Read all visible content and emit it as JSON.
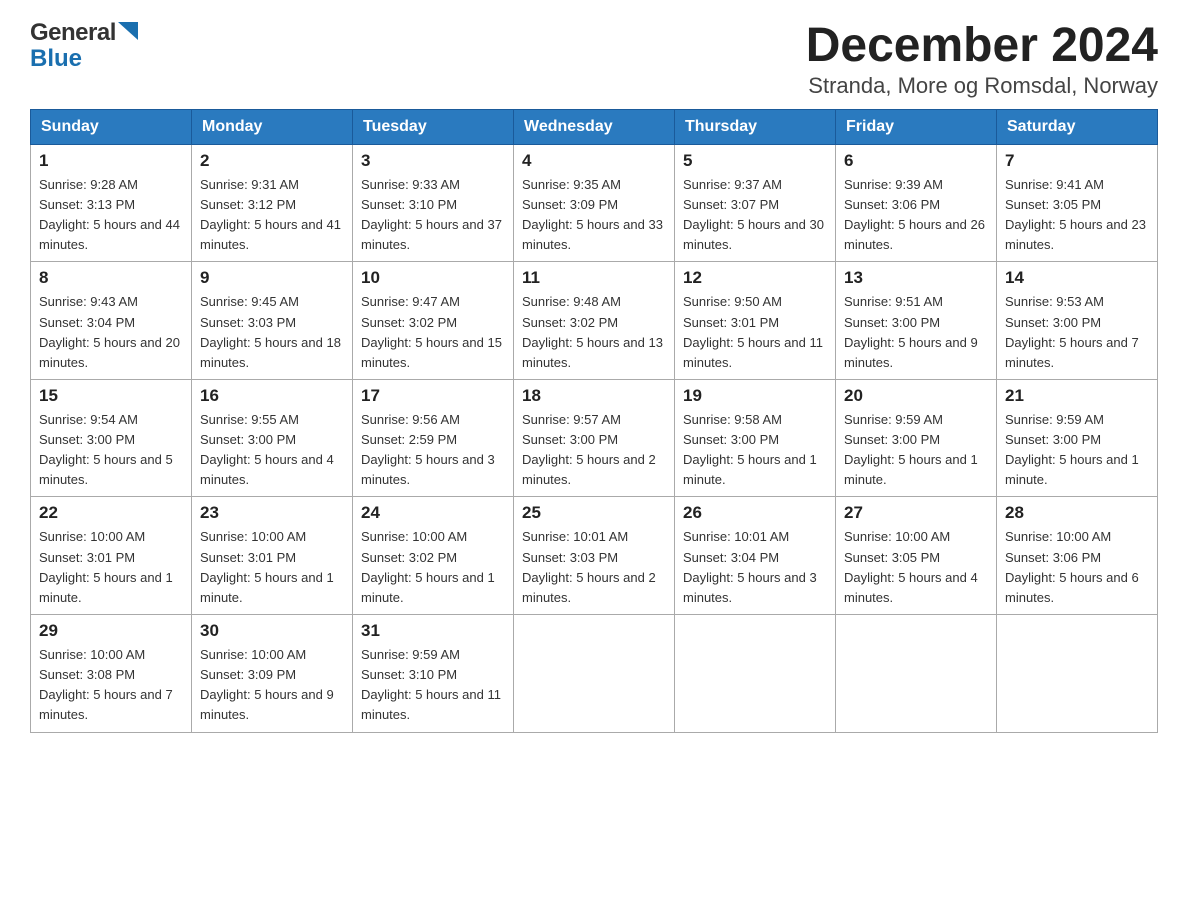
{
  "header": {
    "logo_general": "General",
    "logo_blue": "Blue",
    "title": "December 2024",
    "subtitle": "Stranda, More og Romsdal, Norway"
  },
  "days_of_week": [
    "Sunday",
    "Monday",
    "Tuesday",
    "Wednesday",
    "Thursday",
    "Friday",
    "Saturday"
  ],
  "weeks": [
    [
      {
        "num": "1",
        "sunrise": "Sunrise: 9:28 AM",
        "sunset": "Sunset: 3:13 PM",
        "daylight": "Daylight: 5 hours and 44 minutes."
      },
      {
        "num": "2",
        "sunrise": "Sunrise: 9:31 AM",
        "sunset": "Sunset: 3:12 PM",
        "daylight": "Daylight: 5 hours and 41 minutes."
      },
      {
        "num": "3",
        "sunrise": "Sunrise: 9:33 AM",
        "sunset": "Sunset: 3:10 PM",
        "daylight": "Daylight: 5 hours and 37 minutes."
      },
      {
        "num": "4",
        "sunrise": "Sunrise: 9:35 AM",
        "sunset": "Sunset: 3:09 PM",
        "daylight": "Daylight: 5 hours and 33 minutes."
      },
      {
        "num": "5",
        "sunrise": "Sunrise: 9:37 AM",
        "sunset": "Sunset: 3:07 PM",
        "daylight": "Daylight: 5 hours and 30 minutes."
      },
      {
        "num": "6",
        "sunrise": "Sunrise: 9:39 AM",
        "sunset": "Sunset: 3:06 PM",
        "daylight": "Daylight: 5 hours and 26 minutes."
      },
      {
        "num": "7",
        "sunrise": "Sunrise: 9:41 AM",
        "sunset": "Sunset: 3:05 PM",
        "daylight": "Daylight: 5 hours and 23 minutes."
      }
    ],
    [
      {
        "num": "8",
        "sunrise": "Sunrise: 9:43 AM",
        "sunset": "Sunset: 3:04 PM",
        "daylight": "Daylight: 5 hours and 20 minutes."
      },
      {
        "num": "9",
        "sunrise": "Sunrise: 9:45 AM",
        "sunset": "Sunset: 3:03 PM",
        "daylight": "Daylight: 5 hours and 18 minutes."
      },
      {
        "num": "10",
        "sunrise": "Sunrise: 9:47 AM",
        "sunset": "Sunset: 3:02 PM",
        "daylight": "Daylight: 5 hours and 15 minutes."
      },
      {
        "num": "11",
        "sunrise": "Sunrise: 9:48 AM",
        "sunset": "Sunset: 3:02 PM",
        "daylight": "Daylight: 5 hours and 13 minutes."
      },
      {
        "num": "12",
        "sunrise": "Sunrise: 9:50 AM",
        "sunset": "Sunset: 3:01 PM",
        "daylight": "Daylight: 5 hours and 11 minutes."
      },
      {
        "num": "13",
        "sunrise": "Sunrise: 9:51 AM",
        "sunset": "Sunset: 3:00 PM",
        "daylight": "Daylight: 5 hours and 9 minutes."
      },
      {
        "num": "14",
        "sunrise": "Sunrise: 9:53 AM",
        "sunset": "Sunset: 3:00 PM",
        "daylight": "Daylight: 5 hours and 7 minutes."
      }
    ],
    [
      {
        "num": "15",
        "sunrise": "Sunrise: 9:54 AM",
        "sunset": "Sunset: 3:00 PM",
        "daylight": "Daylight: 5 hours and 5 minutes."
      },
      {
        "num": "16",
        "sunrise": "Sunrise: 9:55 AM",
        "sunset": "Sunset: 3:00 PM",
        "daylight": "Daylight: 5 hours and 4 minutes."
      },
      {
        "num": "17",
        "sunrise": "Sunrise: 9:56 AM",
        "sunset": "Sunset: 2:59 PM",
        "daylight": "Daylight: 5 hours and 3 minutes."
      },
      {
        "num": "18",
        "sunrise": "Sunrise: 9:57 AM",
        "sunset": "Sunset: 3:00 PM",
        "daylight": "Daylight: 5 hours and 2 minutes."
      },
      {
        "num": "19",
        "sunrise": "Sunrise: 9:58 AM",
        "sunset": "Sunset: 3:00 PM",
        "daylight": "Daylight: 5 hours and 1 minute."
      },
      {
        "num": "20",
        "sunrise": "Sunrise: 9:59 AM",
        "sunset": "Sunset: 3:00 PM",
        "daylight": "Daylight: 5 hours and 1 minute."
      },
      {
        "num": "21",
        "sunrise": "Sunrise: 9:59 AM",
        "sunset": "Sunset: 3:00 PM",
        "daylight": "Daylight: 5 hours and 1 minute."
      }
    ],
    [
      {
        "num": "22",
        "sunrise": "Sunrise: 10:00 AM",
        "sunset": "Sunset: 3:01 PM",
        "daylight": "Daylight: 5 hours and 1 minute."
      },
      {
        "num": "23",
        "sunrise": "Sunrise: 10:00 AM",
        "sunset": "Sunset: 3:01 PM",
        "daylight": "Daylight: 5 hours and 1 minute."
      },
      {
        "num": "24",
        "sunrise": "Sunrise: 10:00 AM",
        "sunset": "Sunset: 3:02 PM",
        "daylight": "Daylight: 5 hours and 1 minute."
      },
      {
        "num": "25",
        "sunrise": "Sunrise: 10:01 AM",
        "sunset": "Sunset: 3:03 PM",
        "daylight": "Daylight: 5 hours and 2 minutes."
      },
      {
        "num": "26",
        "sunrise": "Sunrise: 10:01 AM",
        "sunset": "Sunset: 3:04 PM",
        "daylight": "Daylight: 5 hours and 3 minutes."
      },
      {
        "num": "27",
        "sunrise": "Sunrise: 10:00 AM",
        "sunset": "Sunset: 3:05 PM",
        "daylight": "Daylight: 5 hours and 4 minutes."
      },
      {
        "num": "28",
        "sunrise": "Sunrise: 10:00 AM",
        "sunset": "Sunset: 3:06 PM",
        "daylight": "Daylight: 5 hours and 6 minutes."
      }
    ],
    [
      {
        "num": "29",
        "sunrise": "Sunrise: 10:00 AM",
        "sunset": "Sunset: 3:08 PM",
        "daylight": "Daylight: 5 hours and 7 minutes."
      },
      {
        "num": "30",
        "sunrise": "Sunrise: 10:00 AM",
        "sunset": "Sunset: 3:09 PM",
        "daylight": "Daylight: 5 hours and 9 minutes."
      },
      {
        "num": "31",
        "sunrise": "Sunrise: 9:59 AM",
        "sunset": "Sunset: 3:10 PM",
        "daylight": "Daylight: 5 hours and 11 minutes."
      },
      null,
      null,
      null,
      null
    ]
  ]
}
